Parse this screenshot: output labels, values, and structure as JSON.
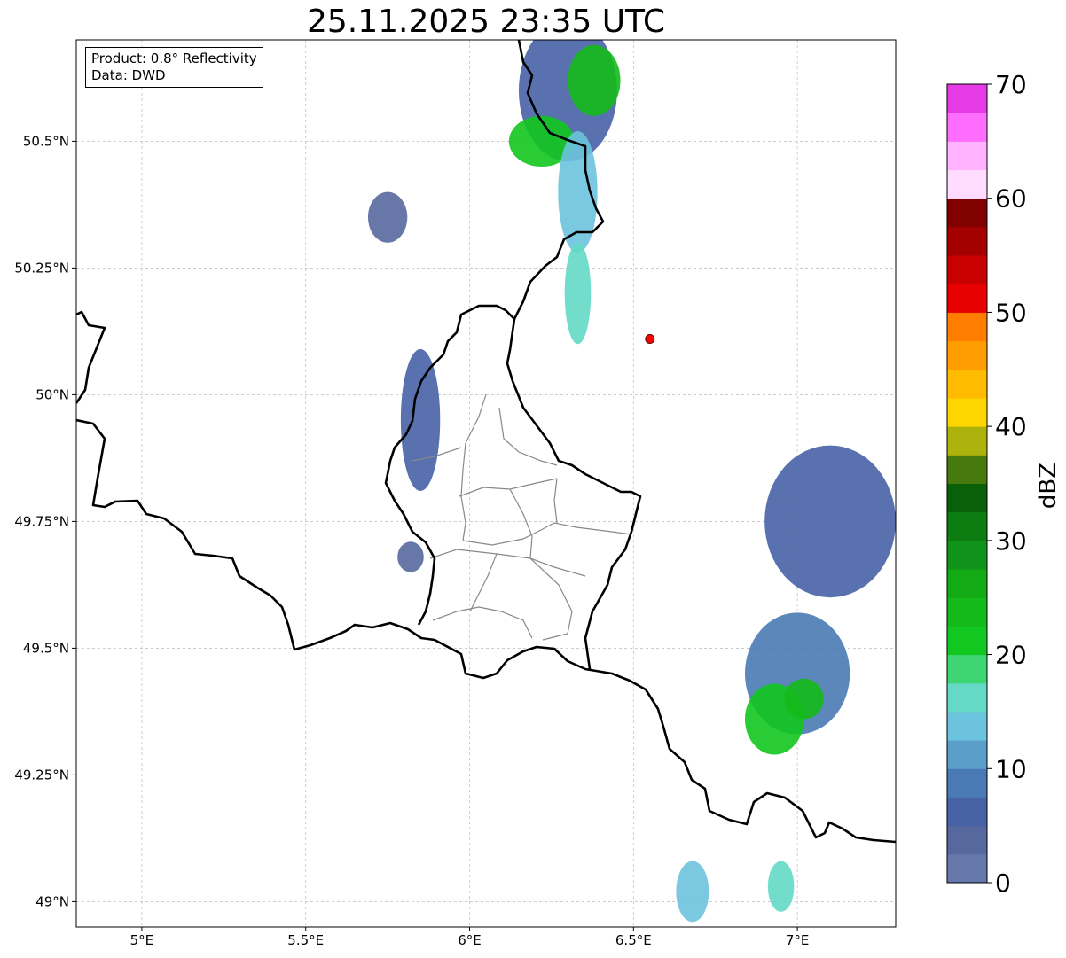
{
  "title": "25.11.2025 23:35 UTC",
  "info": {
    "product": "Product: 0.8° Reflectivity",
    "data": "Data: DWD"
  },
  "axes": {
    "x_ticks": [
      "5°E",
      "5.5°E",
      "6°E",
      "6.5°E",
      "7°E"
    ],
    "y_ticks": [
      "50.5°N",
      "50.25°N",
      "50°N",
      "49.75°N",
      "49.5°N",
      "49.25°N",
      "49°N"
    ],
    "lon_range": [
      4.8,
      7.3
    ],
    "lat_range": [
      48.95,
      50.7
    ],
    "gridlines": true
  },
  "marker": {
    "lon": 6.55,
    "lat": 50.11,
    "color": "#ff0000"
  },
  "colorbar": {
    "label": "dBZ",
    "ticks": [
      "0",
      "10",
      "20",
      "30",
      "40",
      "50",
      "60",
      "70"
    ],
    "range": [
      0,
      70
    ],
    "step": 2.5,
    "colors": [
      "#6577ab",
      "#56689e",
      "#4762a5",
      "#4a7ab4",
      "#5a9ec9",
      "#6bc3dd",
      "#64d9c5",
      "#3dd672",
      "#12c71f",
      "#14ba1a",
      "#12aa15",
      "#0f931a",
      "#0d7d12",
      "#0a5f09",
      "#467a0c",
      "#aeb20c",
      "#fdd500",
      "#ffbb00",
      "#ff9d00",
      "#ff7e00",
      "#e60000",
      "#c80000",
      "#a40000",
      "#810000",
      "#ffdcff",
      "#ffb3ff",
      "#ff6dff",
      "#e63ae6"
    ]
  },
  "radar_cells": [
    {
      "lon": 6.3,
      "lat": 50.6,
      "rlon": 0.15,
      "rlat": 0.14,
      "dbz": 6
    },
    {
      "lon": 6.38,
      "lat": 50.62,
      "rlon": 0.08,
      "rlat": 0.07,
      "dbz": 24
    },
    {
      "lon": 6.22,
      "lat": 50.5,
      "rlon": 0.1,
      "rlat": 0.05,
      "dbz": 22
    },
    {
      "lon": 6.33,
      "lat": 50.4,
      "rlon": 0.06,
      "rlat": 0.12,
      "dbz": 14
    },
    {
      "lon": 6.33,
      "lat": 50.2,
      "rlon": 0.04,
      "rlat": 0.1,
      "dbz": 16
    },
    {
      "lon": 5.85,
      "lat": 49.95,
      "rlon": 0.06,
      "rlat": 0.14,
      "dbz": 5
    },
    {
      "lon": 5.75,
      "lat": 50.35,
      "rlon": 0.06,
      "rlat": 0.05,
      "dbz": 4
    },
    {
      "lon": 5.82,
      "lat": 49.68,
      "rlon": 0.04,
      "rlat": 0.03,
      "dbz": 4
    },
    {
      "lon": 7.1,
      "lat": 49.75,
      "rlon": 0.2,
      "rlat": 0.15,
      "dbz": 6
    },
    {
      "lon": 7.0,
      "lat": 49.45,
      "rlon": 0.16,
      "rlat": 0.12,
      "dbz": 8
    },
    {
      "lon": 6.93,
      "lat": 49.36,
      "rlon": 0.09,
      "rlat": 0.07,
      "dbz": 20
    },
    {
      "lon": 7.02,
      "lat": 49.4,
      "rlon": 0.06,
      "rlat": 0.04,
      "dbz": 24
    },
    {
      "lon": 6.68,
      "lat": 49.02,
      "rlon": 0.05,
      "rlat": 0.06,
      "dbz": 14
    },
    {
      "lon": 6.95,
      "lat": 49.03,
      "rlon": 0.04,
      "rlat": 0.05,
      "dbz": 16
    }
  ]
}
